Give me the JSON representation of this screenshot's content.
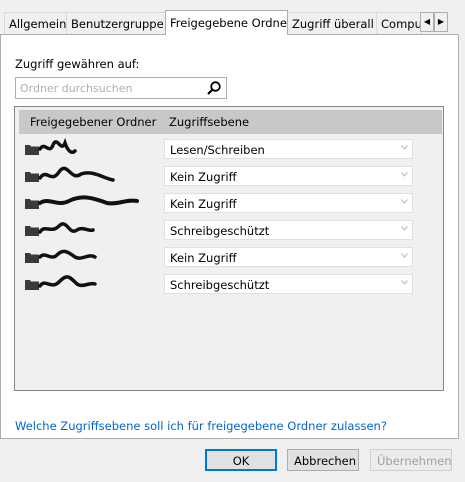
{
  "tabs": [
    "Allgemein",
    "Benutzergruppe",
    "Freigegebene Ordner",
    "Zugriff überall",
    "Compu"
  ],
  "active_tab": "Freigegebene Ordner",
  "grant_label": "Zugriff gewähren auf:",
  "search": {
    "placeholder": "Ordner durchsuchen"
  },
  "table": {
    "columns": [
      "Freigegebener Ordner",
      "Zugriffsebene"
    ],
    "rows": [
      {
        "access": "Lesen/Schreiben"
      },
      {
        "access": "Kein Zugriff"
      },
      {
        "access": "Kein Zugriff"
      },
      {
        "access": "Schreibgeschützt"
      },
      {
        "access": "Kein Zugriff"
      },
      {
        "access": "Schreibgeschützt"
      }
    ]
  },
  "help_link": "Welche Zugriffsebene soll ich für freigegebene Ordner zulassen?",
  "buttons": {
    "ok": "OK",
    "cancel": "Abbrechen",
    "apply": "Übernehmen"
  },
  "icons": {
    "folder": "folder-icon",
    "search": "magnifier-icon",
    "dropdown": "chevron-down-icon",
    "scroll_left": "triangle-left-icon",
    "scroll_right": "triangle-right-icon"
  },
  "colors": {
    "link": "#0066cc",
    "default_button_border": "#0078d7",
    "header_bg": "#c8c8c8"
  }
}
